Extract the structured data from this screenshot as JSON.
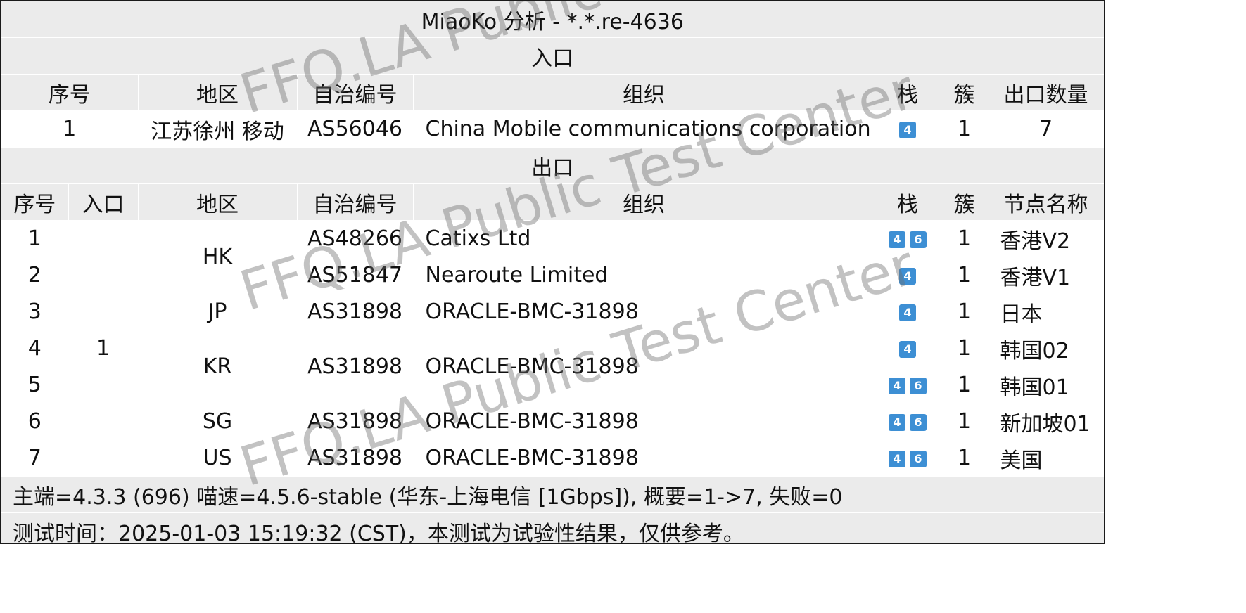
{
  "title": "MiaoKo 分析 - *.*.re-4636",
  "entry_section": {
    "title": "入口",
    "headers": [
      "序号",
      "地区",
      "自治编号",
      "组织",
      "栈",
      "簇",
      "出口数量"
    ],
    "row": {
      "index": "1",
      "region": "江苏徐州 移动",
      "asn": "AS56046",
      "org": "China Mobile communications corporation",
      "stack": [
        "4"
      ],
      "cluster": "1",
      "exit_count": "7"
    }
  },
  "exit_section": {
    "title": "出口",
    "headers": [
      "序号",
      "入口",
      "地区",
      "自治编号",
      "组织",
      "栈",
      "簇",
      "节点名称"
    ],
    "entry_value": "1",
    "regions": {
      "hk": "HK",
      "jp": "JP",
      "kr": "KR",
      "sg": "SG",
      "us": "US"
    },
    "rows": [
      {
        "index": "1",
        "asn": "AS48266",
        "org": "Catixs Ltd",
        "stack": [
          "4",
          "6"
        ],
        "cluster": "1",
        "node": "香港V2"
      },
      {
        "index": "2",
        "asn": "AS51847",
        "org": "Nearoute Limited",
        "stack": [
          "4"
        ],
        "cluster": "1",
        "node": "香港V1"
      },
      {
        "index": "3",
        "asn": "AS31898",
        "org": "ORACLE-BMC-31898",
        "stack": [
          "4"
        ],
        "cluster": "1",
        "node": "日本"
      },
      {
        "index": "4",
        "asn": "AS31898",
        "org": "ORACLE-BMC-31898",
        "stack": [
          "4"
        ],
        "cluster": "1",
        "node": "韩国02"
      },
      {
        "index": "5",
        "asn": "",
        "org": "",
        "stack": [
          "4",
          "6"
        ],
        "cluster": "1",
        "node": "韩国01"
      },
      {
        "index": "6",
        "asn": "AS31898",
        "org": "ORACLE-BMC-31898",
        "stack": [
          "4",
          "6"
        ],
        "cluster": "1",
        "node": "新加坡01"
      },
      {
        "index": "7",
        "asn": "AS31898",
        "org": "ORACLE-BMC-31898",
        "stack": [
          "4",
          "6"
        ],
        "cluster": "1",
        "node": "美国"
      }
    ]
  },
  "footer": {
    "version_line": "主端=4.3.3 (696) 喵速=4.5.6-stable (华东-上海电信 [1Gbps]), 概要=1->7, 失败=0",
    "time_line": "测试时间：2025-01-03 15:19:32 (CST)，本测试为试验性结果，仅供参考。"
  },
  "watermark": {
    "top": "FFQ.LA Public Test",
    "lines": [
      "FFQ.LA Public Test Center",
      "FFQ.LA Public Test Center"
    ]
  },
  "colors": {
    "badge": "#3d8fd4",
    "header_bg": "#ebebeb",
    "border": "#1a1a1a"
  }
}
